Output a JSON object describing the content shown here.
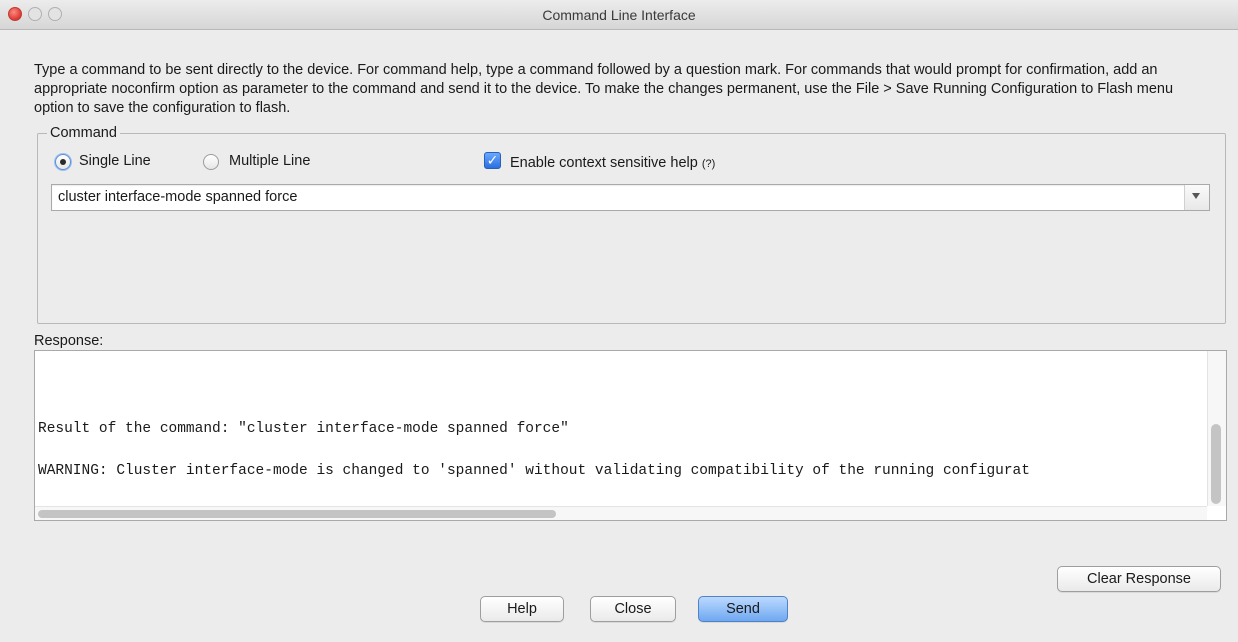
{
  "window": {
    "title": "Command Line Interface"
  },
  "description": "Type a command to be sent directly to the device. For command help, type a command followed by a question mark. For commands that would prompt for confirmation, add an appropriate noconfirm option as parameter to the command and send it to the device. To make the changes permanent, use the File > Save Running Configuration to Flash menu option to save the configuration to flash.",
  "command": {
    "legend": "Command",
    "mode_options": [
      {
        "label": "Single Line",
        "selected": true
      },
      {
        "label": "Multiple Line",
        "selected": false
      }
    ],
    "context_help": {
      "label": "Enable context sensitive help",
      "hint": "(?)",
      "checked": true
    },
    "input_value": "cluster interface-mode spanned force"
  },
  "response": {
    "label": "Response:",
    "lines": [
      "Result of the command: \"cluster interface-mode spanned force\"",
      "WARNING: Cluster interface-mode is changed to 'spanned' without validating compatibility of the running configurat"
    ]
  },
  "buttons": {
    "clear_response": "Clear Response",
    "help": "Help",
    "close": "Close",
    "send": "Send"
  }
}
